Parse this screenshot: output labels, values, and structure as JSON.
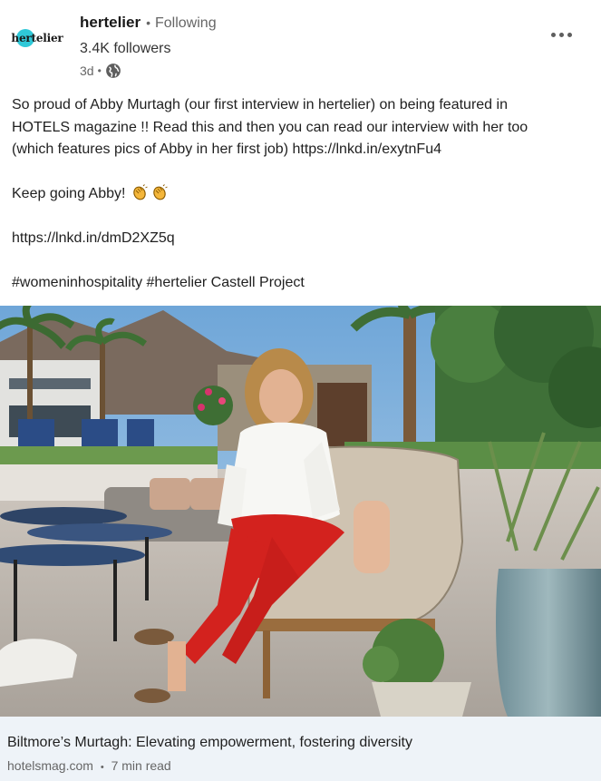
{
  "header": {
    "logo_text": "hertelier",
    "author_name": "hertelier",
    "separator": "•",
    "follow_status": "Following",
    "followers": "3.4K followers",
    "time_ago": "3d",
    "visibility_icon": "globe-icon",
    "more_icon": "more-horizontal-icon"
  },
  "post": {
    "line1": "So proud of Abby Murtagh (our first interview in hertelier) on being featured in",
    "line2": "HOTELS magazine !! Read this and then you can read our interview with her too",
    "line3": "(which features pics of Abby in her first job) https://lnkd.in/exytnFu4",
    "keep_going": "Keep going Abby!",
    "emoji": "clapping-hands-icon",
    "link2": "https://lnkd.in/dmD2XZ5q",
    "hashtags": "#womeninhospitality #hertelier Castell Project"
  },
  "article": {
    "image_alt": "woman-in-white-shirt-seated-on-patio-chair",
    "title": "Biltmore’s Murtagh: Elevating empowerment, fostering diversity",
    "source": "hotelsmag.com",
    "separator": "•",
    "read_time": "7 min read"
  },
  "colors": {
    "brand_teal": "#2fc8d8",
    "link_card_bg": "#eef3f8",
    "muted_text": "#666666"
  }
}
